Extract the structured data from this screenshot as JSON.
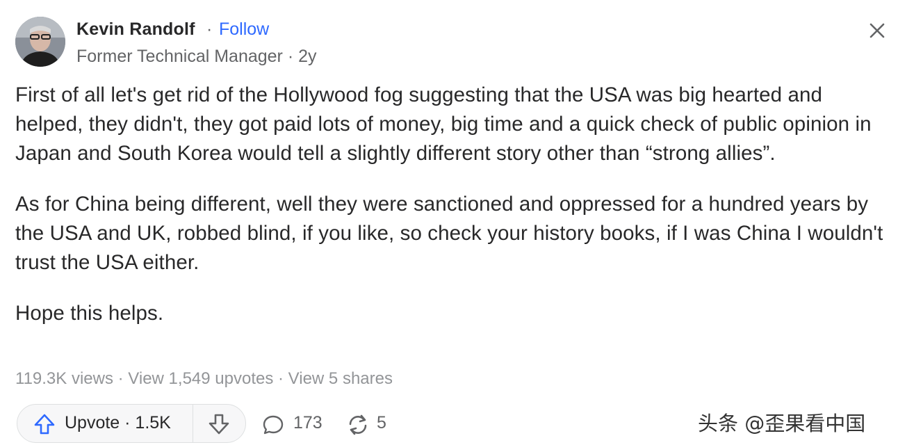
{
  "author": {
    "name": "Kevin Randolf",
    "separator": "·",
    "follow_label": "Follow",
    "credential": "Former Technical Manager · 2y"
  },
  "answer": {
    "paragraphs": [
      "First of all let's get rid of the Hollywood fog suggesting that the USA was big hearted and helped, they didn't, they got paid lots of money, big time and a quick check of public opinion in Japan and South Korea would tell a slightly different story other than “strong allies”.",
      "As for China being different, well they were sanctioned and oppressed for a hundred years by the USA and UK, robbed blind, if you like, so check your history books, if I was China I wouldn't trust the USA either.",
      "Hope this helps."
    ]
  },
  "stats": {
    "views": "119.3K views",
    "sep": " · ",
    "upvotes": "View 1,549 upvotes",
    "shares": "View 5 shares"
  },
  "actions": {
    "upvote_label": "Upvote · 1.5K",
    "comment_count": "173",
    "share_count": "5"
  },
  "icons": {
    "close": "close-icon",
    "upvote": "upvote-arrow-icon",
    "downvote": "downvote-arrow-icon",
    "comment": "comment-bubble-icon",
    "share": "share-icon"
  },
  "colors": {
    "follow": "#2e69ff",
    "upvote_icon": "#2e69ff",
    "text": "#282829",
    "secondary": "#636466",
    "muted": "#939598"
  },
  "watermark": "头条 @歪果看中国"
}
